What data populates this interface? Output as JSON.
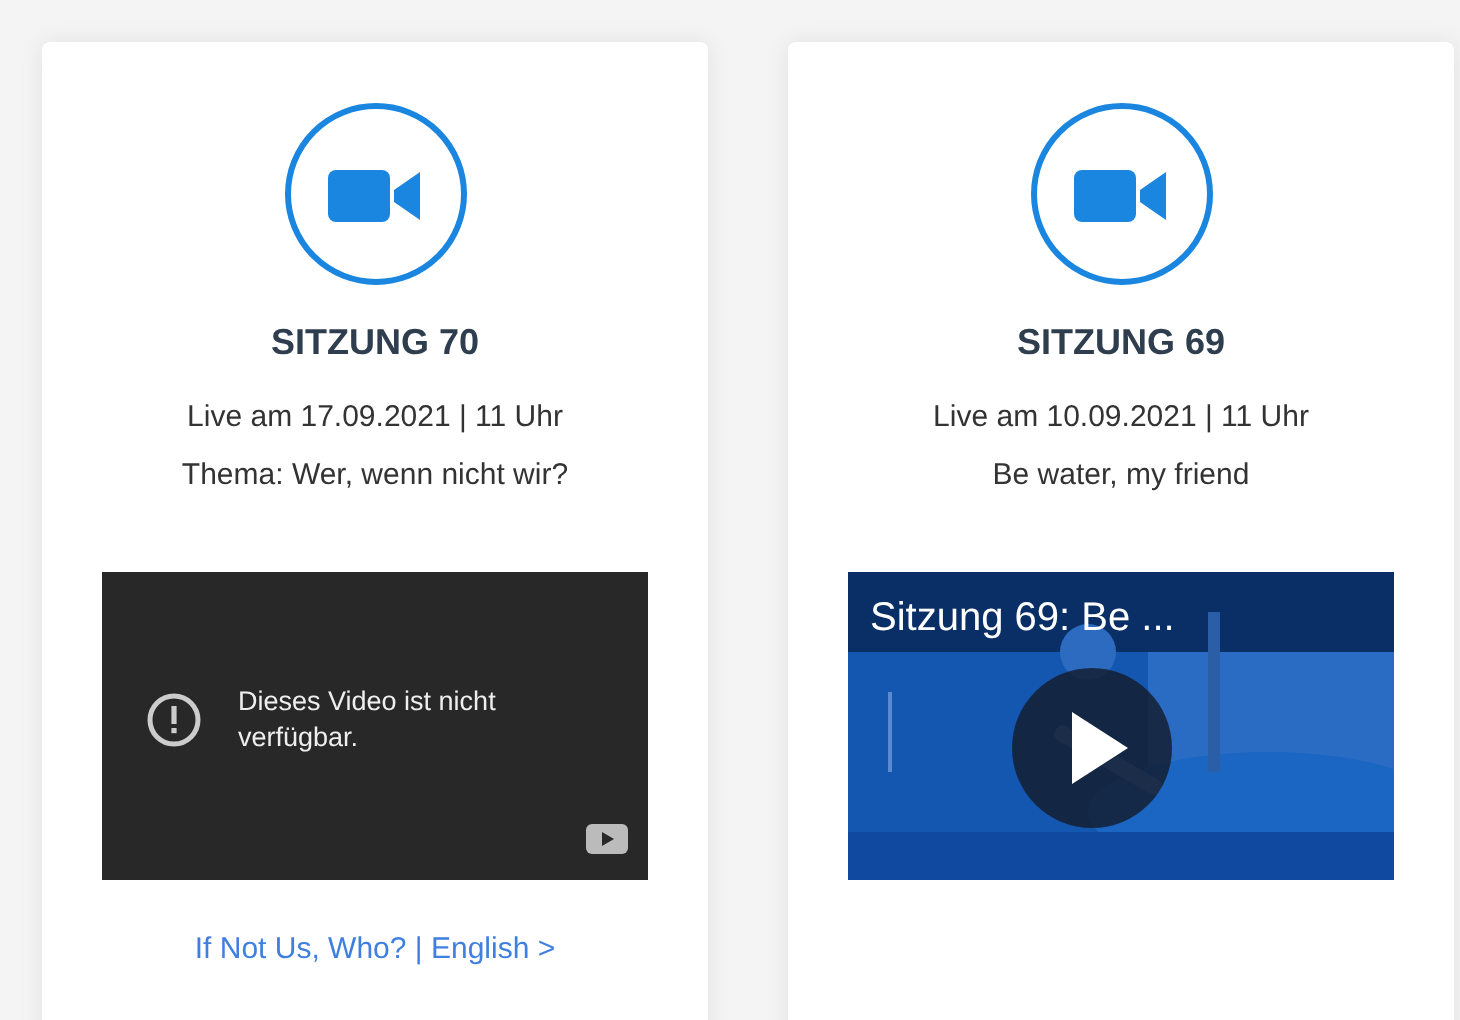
{
  "cards": [
    {
      "title": "SITZUNG 70",
      "date": "Live am 17.09.2021 | 11 Uhr",
      "topic": "Thema: Wer, wenn nicht wir?",
      "video": {
        "kind": "unavailable",
        "message": "Dieses Video ist nicht verfügbar."
      },
      "link": "If Not Us, Who? | English >"
    },
    {
      "title": "SITZUNG 69",
      "date": "Live am 10.09.2021 | 11 Uhr",
      "topic": "Be water, my friend",
      "video": {
        "kind": "player",
        "title": "Sitzung 69: Be ..."
      }
    }
  ]
}
